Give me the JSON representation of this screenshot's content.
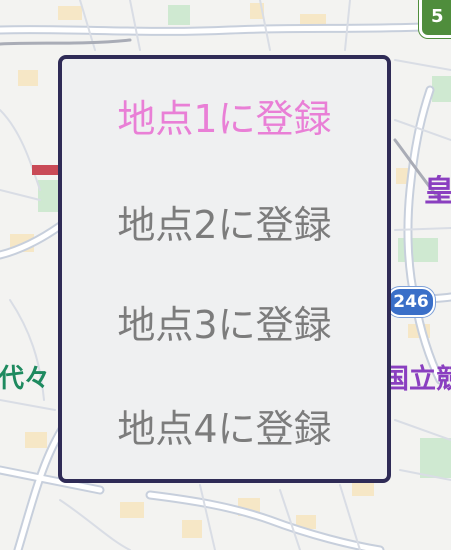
{
  "map": {
    "labels": {
      "yoyogi": "代々",
      "koukyo": "皇",
      "kokuritsu": "国立競"
    },
    "route_shield": "246",
    "corner_shield": "5",
    "colors": {
      "background": "#f3f3f1",
      "road": "#ffffff",
      "road_outline": "#c7cfdc",
      "park": "#cfe9d1",
      "building_tint": "#f6e7c6"
    }
  },
  "menu": {
    "items": [
      {
        "label": "地点1に登録",
        "active": true
      },
      {
        "label": "地点2に登録",
        "active": false
      },
      {
        "label": "地点3に登録",
        "active": false
      },
      {
        "label": "地点4に登録",
        "active": false
      }
    ],
    "colors": {
      "background": "#eff0f1",
      "border": "#2f2b56",
      "active_text": "#e97fd6",
      "text": "#7c7c7c"
    }
  }
}
